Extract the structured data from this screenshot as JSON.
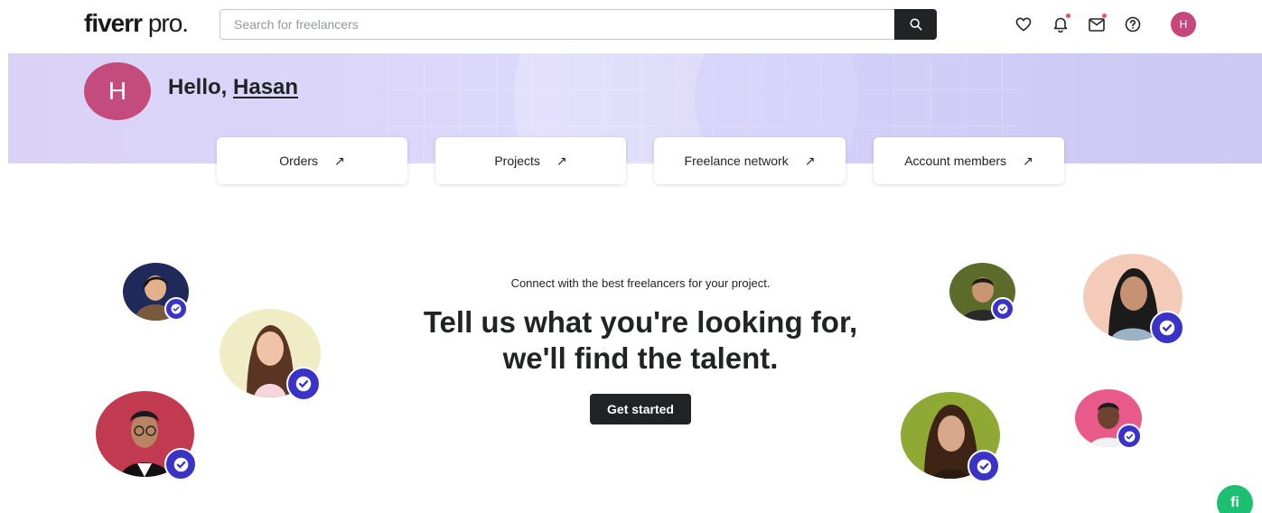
{
  "header": {
    "logo_bold": "fiverr",
    "logo_light": " pro.",
    "search_placeholder": "Search for freelancers",
    "icons": [
      "heart-icon",
      "bell-icon",
      "mail-icon",
      "help-icon"
    ],
    "avatar_initial": "H"
  },
  "banner": {
    "avatar_initial": "H",
    "greeting": "Hello, ",
    "user_name": "Hasan"
  },
  "quick_links": [
    {
      "label": "Orders",
      "arrow": "↗"
    },
    {
      "label": "Projects",
      "arrow": "↗"
    },
    {
      "label": "Freelance network",
      "arrow": "↗"
    },
    {
      "label": "Account members",
      "arrow": "↗"
    }
  ],
  "hero": {
    "subtitle": "Connect with the best freelancers for your project.",
    "headline_line1": "Tell us what you're looking for,",
    "headline_line2": "we'll find the talent.",
    "cta_label": "Get started"
  },
  "chat": {
    "label": "fi"
  },
  "colors": {
    "brand_dark": "#222325",
    "banner_lavender": "#d9d2f6",
    "verified_badge": "#3a33c7",
    "notification_dot": "#e5535b",
    "user_avatar": "#c5477e",
    "chat_green": "#1dbf73"
  }
}
